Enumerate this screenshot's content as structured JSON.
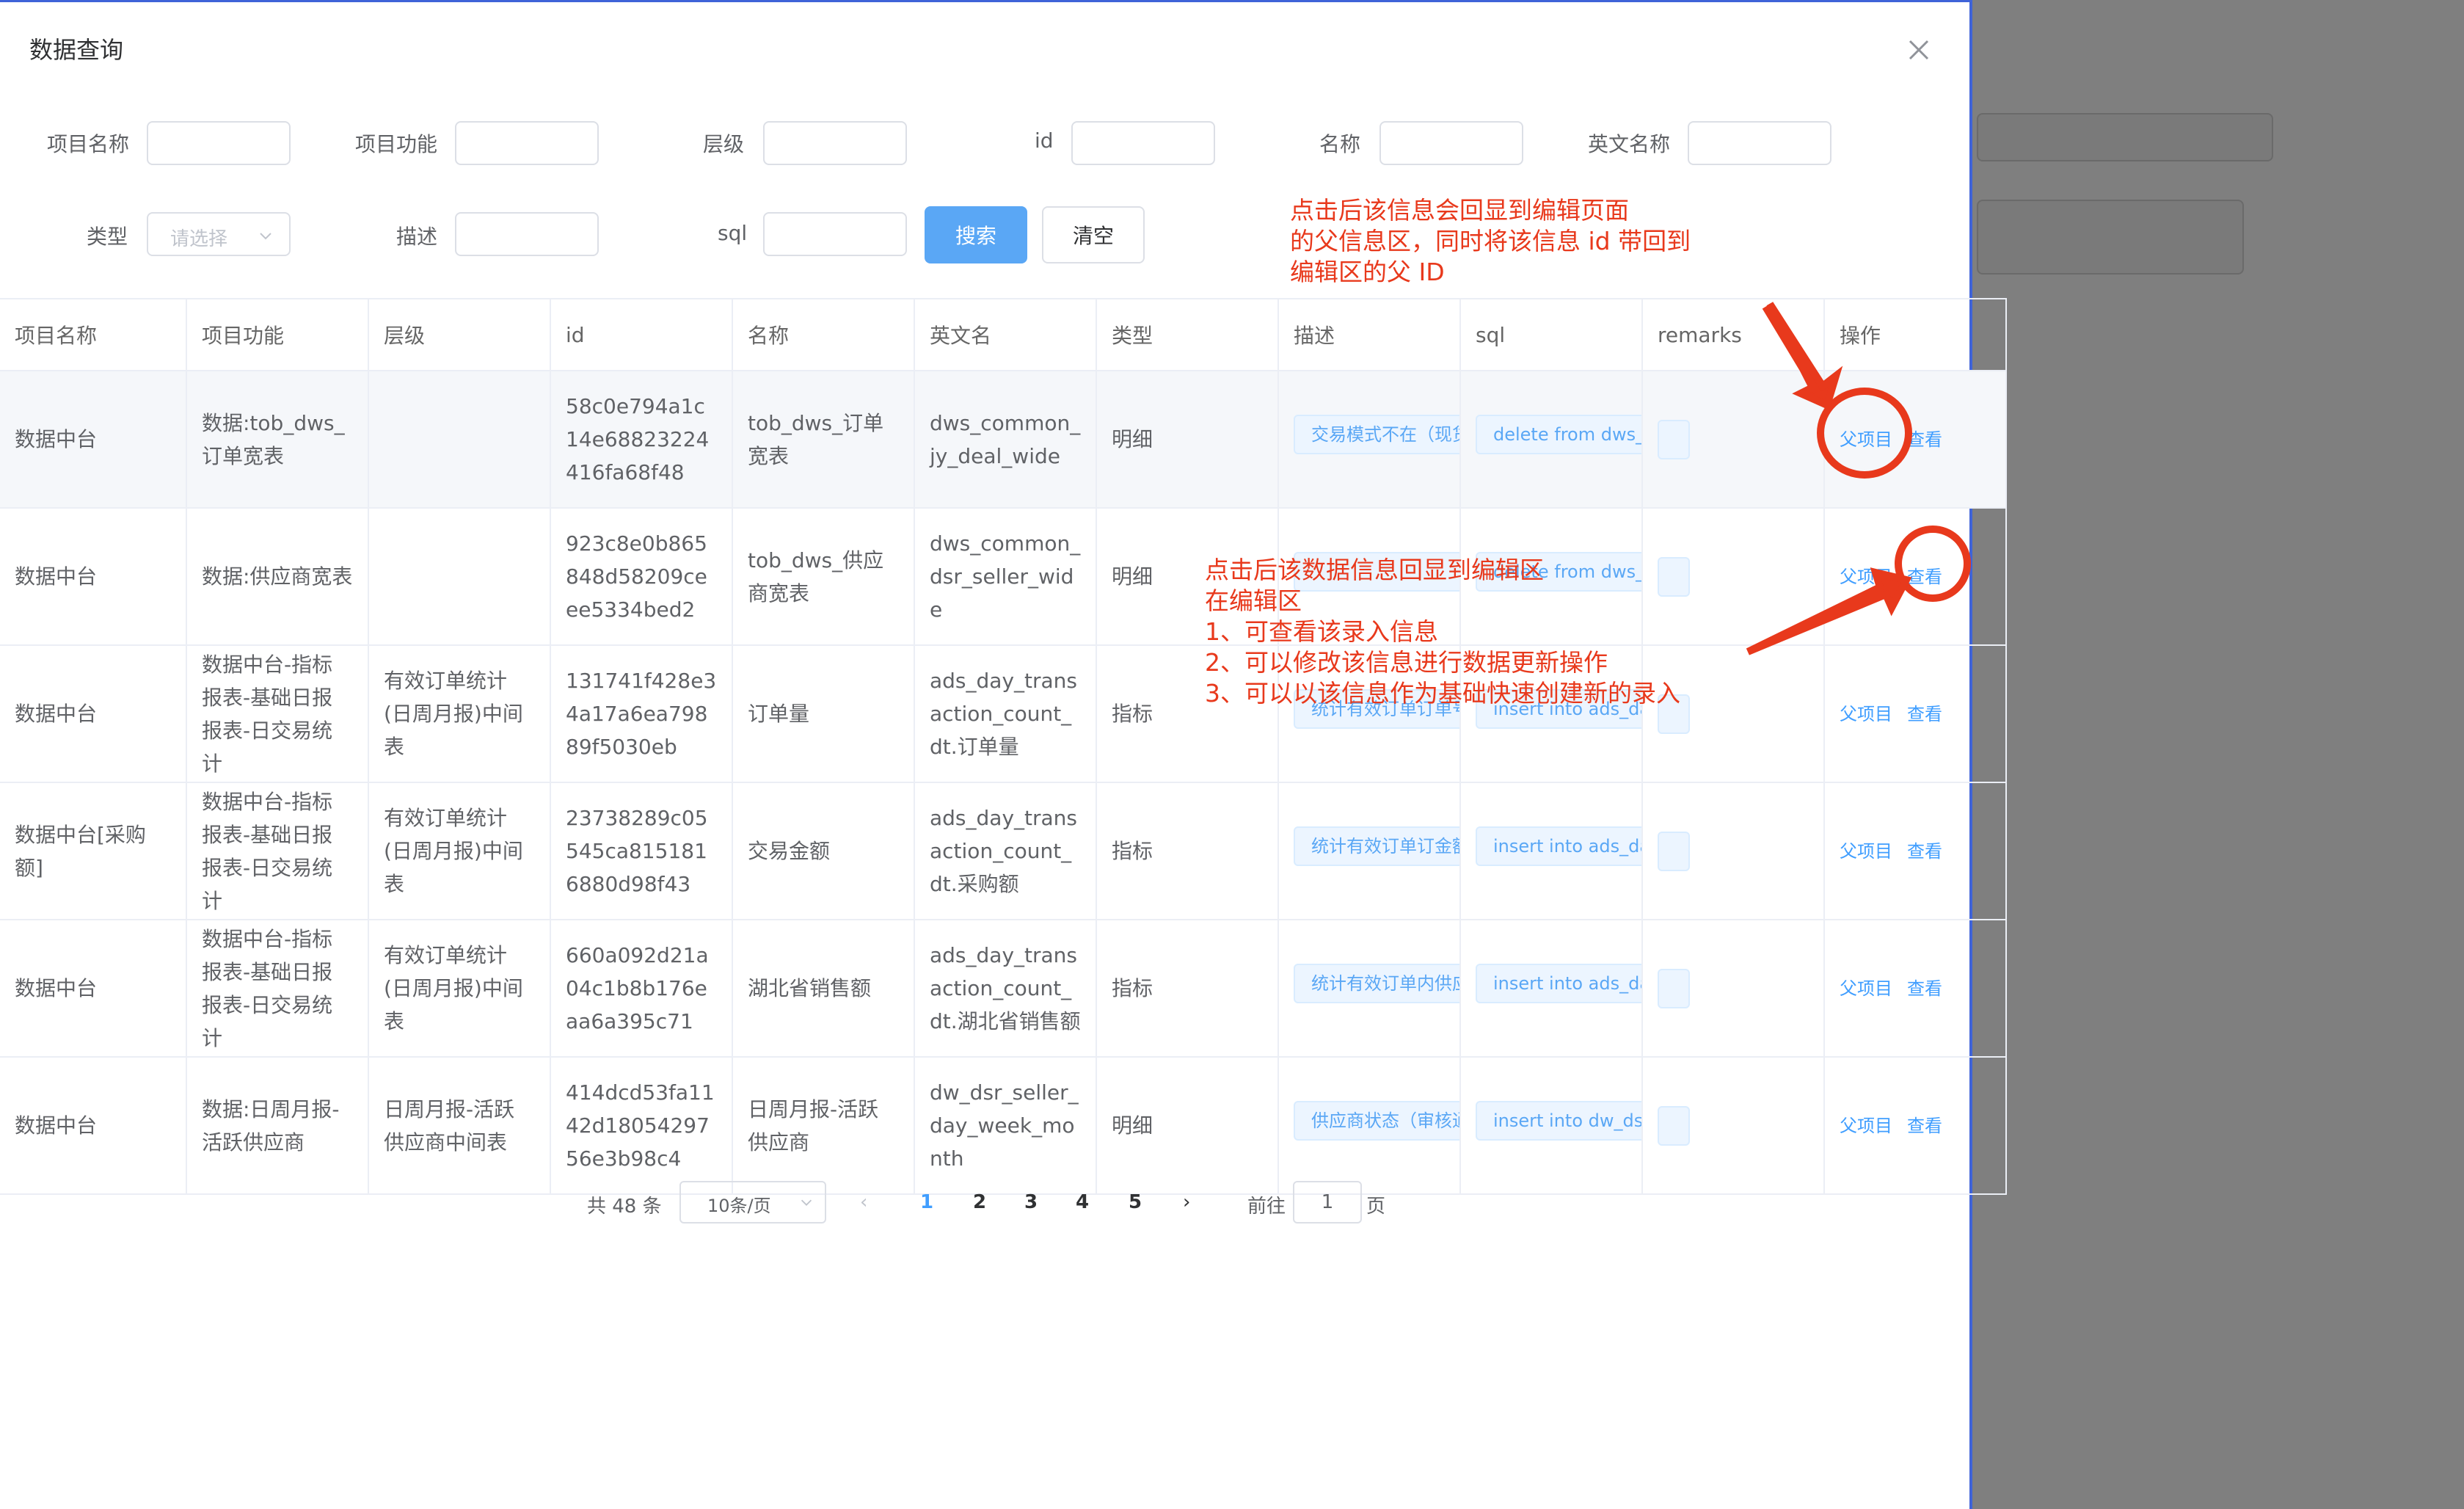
{
  "dialog": {
    "title": "数据查询"
  },
  "filters": {
    "project_name": {
      "label": "项目名称",
      "value": ""
    },
    "project_func": {
      "label": "项目功能",
      "value": ""
    },
    "level": {
      "label": "层级",
      "value": ""
    },
    "id": {
      "label": "id",
      "value": ""
    },
    "name": {
      "label": "名称",
      "value": ""
    },
    "en_name": {
      "label": "英文名称",
      "value": ""
    },
    "type": {
      "label": "类型",
      "placeholder": "请选择"
    },
    "desc": {
      "label": "描述",
      "value": ""
    },
    "sql": {
      "label": "sql",
      "value": ""
    },
    "search_label": "搜索",
    "clear_label": "清空"
  },
  "table": {
    "headers": [
      "项目名称",
      "项目功能",
      "层级",
      "id",
      "名称",
      "英文名",
      "类型",
      "描述",
      "sql",
      "remarks",
      "操作"
    ],
    "rows": [
      {
        "project": "数据中台",
        "func": "数据:tob_dws_订单宽表",
        "level": "",
        "id": "58c0e794a1c14e68823224416fa68f48",
        "name": "tob_dws_订单宽表",
        "en": "dws_common_jy_deal_wide",
        "type": "明细",
        "desc": "交易模式不在（现货",
        "sql": "delete from dws_co"
      },
      {
        "project": "数据中台",
        "func": "数据:供应商宽表",
        "level": "",
        "id": "923c8e0b865848d58209ceee5334bed2",
        "name": "tob_dws_供应商宽表",
        "en": "dws_common_dsr_seller_wide",
        "type": "明细",
        "desc": "",
        "sql": "delete from dws_co"
      },
      {
        "project": "数据中台",
        "func": "数据中台-指标报表-基础日报报表-日交易统计",
        "level": "有效订单统计(日周月报)中间表",
        "id": "131741f428e34a17a6ea79889f5030eb",
        "name": "订单量",
        "en": "ads_day_transaction_count_dt.订单量",
        "type": "指标",
        "desc": "统计有效订单订单号",
        "sql": "insert into ads_day"
      },
      {
        "project": "数据中台[采购额]",
        "func": "数据中台-指标报表-基础日报报表-日交易统计",
        "level": "有效订单统计(日周月报)中间表",
        "id": "23738289c05545ca8151816880d98f43",
        "name": "交易金额",
        "en": "ads_day_transaction_count_dt.采购额",
        "type": "指标",
        "desc": "统计有效订单订金额",
        "sql": "insert into ads_day"
      },
      {
        "project": "数据中台",
        "func": "数据中台-指标报表-基础日报报表-日交易统计",
        "level": "有效订单统计(日周月报)中间表",
        "id": "660a092d21a04c1b8b176eaa6a395c71",
        "name": "湖北省销售额",
        "en": "ads_day_transaction_count_dt.湖北省销售额",
        "type": "指标",
        "desc": "统计有效订单内供应",
        "sql": "insert into ads_day"
      },
      {
        "project": "数据中台",
        "func": "数据:日周月报-活跃供应商",
        "level": "日周月报-活跃供应商中间表",
        "id": "414dcd53fa1142d1805429756e3b98c4",
        "name": "日周月报-活跃供应商",
        "en": "dw_dsr_seller_day_week_month",
        "type": "明细",
        "desc": "供应商状态（审核通",
        "sql": "insert into dw_dsr_"
      }
    ],
    "op_parent": "父项目",
    "op_view": "查看"
  },
  "pagination": {
    "total_text": "共 48 条",
    "page_size": "10条/页",
    "pages": [
      "1",
      "2",
      "3",
      "4",
      "5"
    ],
    "goto_label": "前往",
    "goto_value": "1",
    "goto_unit": "页"
  },
  "annotations": {
    "top": "点击后该信息会回显到编辑页面\n的父信息区，同时将该信息 id 带回到\n编辑区的父 ID",
    "middle": "点击后该数据信息回显到编辑区\n在编辑区\n1、可查看该录入信息\n2、可以修改该信息进行数据更新操作\n3、可以以该信息作为基础快速创建新的录入"
  },
  "colors": {
    "primary": "#409eff",
    "annotation": "#e8391c"
  }
}
